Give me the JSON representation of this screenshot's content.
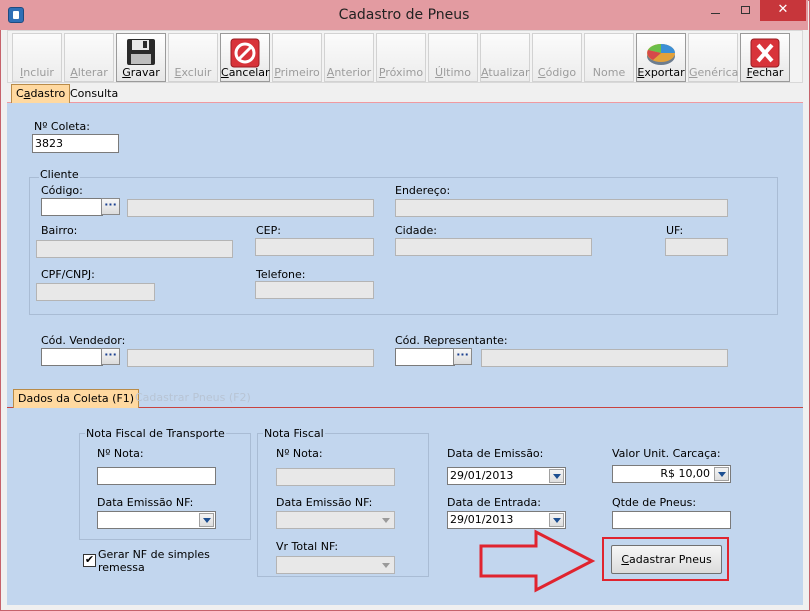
{
  "window": {
    "title": "Cadastro de Pneus",
    "close_glyph": "✕"
  },
  "toolbar": {
    "incluir": {
      "pre": "",
      "key": "I",
      "post": "ncluir"
    },
    "alterar": {
      "pre": "",
      "key": "A",
      "post": "lterar"
    },
    "gravar": {
      "pre": "",
      "key": "G",
      "post": "ravar"
    },
    "excluir": {
      "pre": "",
      "key": "E",
      "post": "xcluir"
    },
    "cancelar": {
      "pre": "",
      "key": "C",
      "post": "ancelar"
    },
    "primeiro": {
      "pre": "",
      "key": "P",
      "post": "rimeiro"
    },
    "anterior": {
      "pre": "",
      "key": "A",
      "post": "nterior"
    },
    "proximo": {
      "pre": "",
      "key": "P",
      "post": "róximo"
    },
    "ultimo": {
      "pre": "",
      "key": "Ú",
      "post": "ltimo"
    },
    "atualizar": {
      "pre": "",
      "key": "A",
      "post": "tualizar"
    },
    "codigo": {
      "pre": "",
      "key": "C",
      "post": "ódigo"
    },
    "nome": {
      "pre": "Nome",
      "key": "",
      "post": ""
    },
    "exportar": {
      "pre": "",
      "key": "E",
      "post": "xportar"
    },
    "generica": {
      "pre": "",
      "key": "G",
      "post": "enérica"
    },
    "fechar": {
      "pre": "",
      "key": "F",
      "post": "echar"
    }
  },
  "tabs": {
    "cadastro": {
      "pre": "C",
      "key": "a",
      "post": "dastro"
    },
    "consulta": "Consulta"
  },
  "form": {
    "num_coleta_label": "Nº Coleta:",
    "num_coleta_value": "3823",
    "cliente_label": "Cliente",
    "codigo_label": "Código:",
    "endereco_label": "Endereço:",
    "bairro_label": "Bairro:",
    "cep_label": "CEP:",
    "cidade_label": "Cidade:",
    "uf_label": "UF:",
    "cpf_label": "CPF/CNPJ:",
    "telefone_label": "Telefone:",
    "vendedor_label": "Cód. Vendedor:",
    "representante_label": "Cód. Representante:",
    "lookup_glyph": "···"
  },
  "subtabs": {
    "dados_coleta": "Dados da Coleta (F1)",
    "cadastrar_pneus": "Cadastrar Pneus (F2)"
  },
  "coleta": {
    "nf_transporte_title": "Nota Fiscal de Transporte",
    "nf_title": "Nota Fiscal",
    "num_nota_label": "Nº Nota:",
    "data_emissao_nf_label": "Data Emissão NF:",
    "vr_total_nf_label": "Vr Total NF:",
    "data_emissao_label": "Data de Emissão:",
    "data_emissao_value": "29/01/2013",
    "data_entrada_label": "Data de Entrada:",
    "data_entrada_value": "29/01/2013",
    "valor_carcaca_label": "Valor Unit. Carcaça:",
    "valor_carcaca_value": "R$ 10,00",
    "qtde_pneus_label": "Qtde de Pneus:",
    "gerar_nf_label_1": "Gerar NF de simples",
    "gerar_nf_label_2": "remessa",
    "gerar_nf_checked": "✔",
    "cadastrar_button_key": "C",
    "cadastrar_button_rest": "adastrar Pneus"
  }
}
